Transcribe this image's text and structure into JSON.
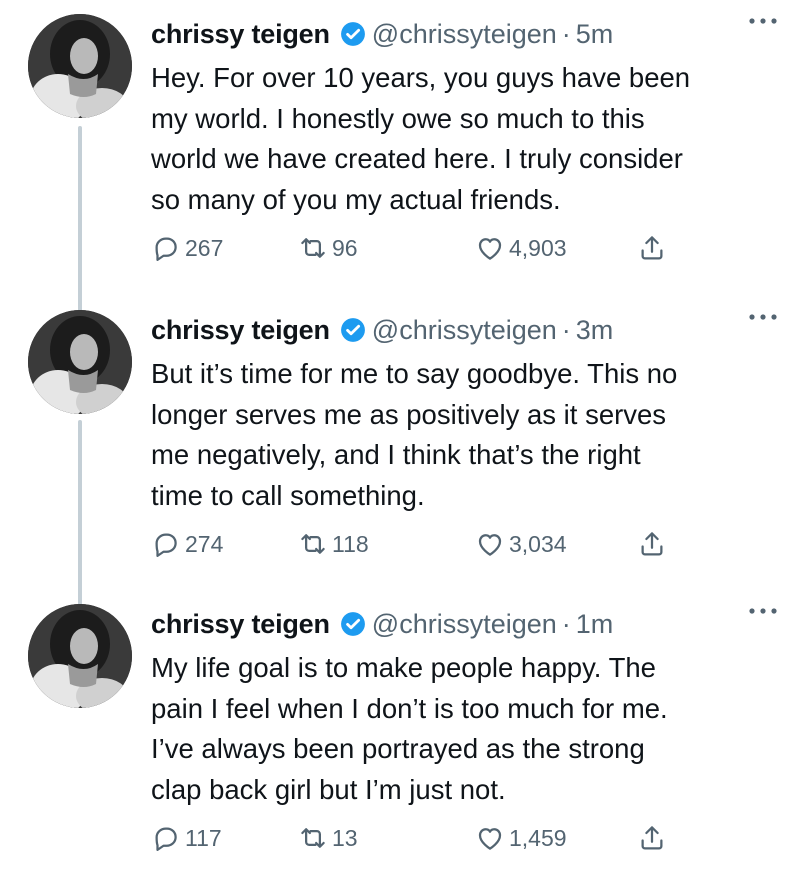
{
  "colors": {
    "text": "#0f1419",
    "secondary": "#536471",
    "verified": "#1d9bf0",
    "thread_line": "#c4cfd6"
  },
  "tweets": [
    {
      "name": "chrissy teigen",
      "handle": "@chrissyteigen",
      "separator": "·",
      "time": "5m",
      "lines": [
        "Hey. For over 10 years, you guys have been",
        "my world. I honestly owe so much to this",
        "world we have created here. I truly consider",
        "so many of you my actual friends."
      ],
      "replies": "267",
      "retweets": "96",
      "likes": "4,903"
    },
    {
      "name": "chrissy teigen",
      "handle": "@chrissyteigen",
      "separator": "·",
      "time": "3m",
      "lines": [
        "But it’s time for me to say goodbye. This no",
        "longer serves me as positively as it serves",
        "me negatively, and I think that’s the right",
        "time to call something."
      ],
      "replies": "274",
      "retweets": "118",
      "likes": "3,034"
    },
    {
      "name": "chrissy teigen",
      "handle": "@chrissyteigen",
      "separator": "·",
      "time": "1m",
      "lines": [
        "My life goal is to make people happy. The",
        "pain I feel when I don’t is too much for me.",
        "I’ve always been portrayed as the strong",
        "clap back girl but I’m just not."
      ],
      "replies": "117",
      "retweets": "13",
      "likes": "1,459"
    }
  ],
  "icons": {
    "reply": "reply-icon",
    "retweet": "retweet-icon",
    "like": "heart-icon",
    "share": "share-icon",
    "more": "more-icon",
    "verified": "verified-badge-icon"
  }
}
